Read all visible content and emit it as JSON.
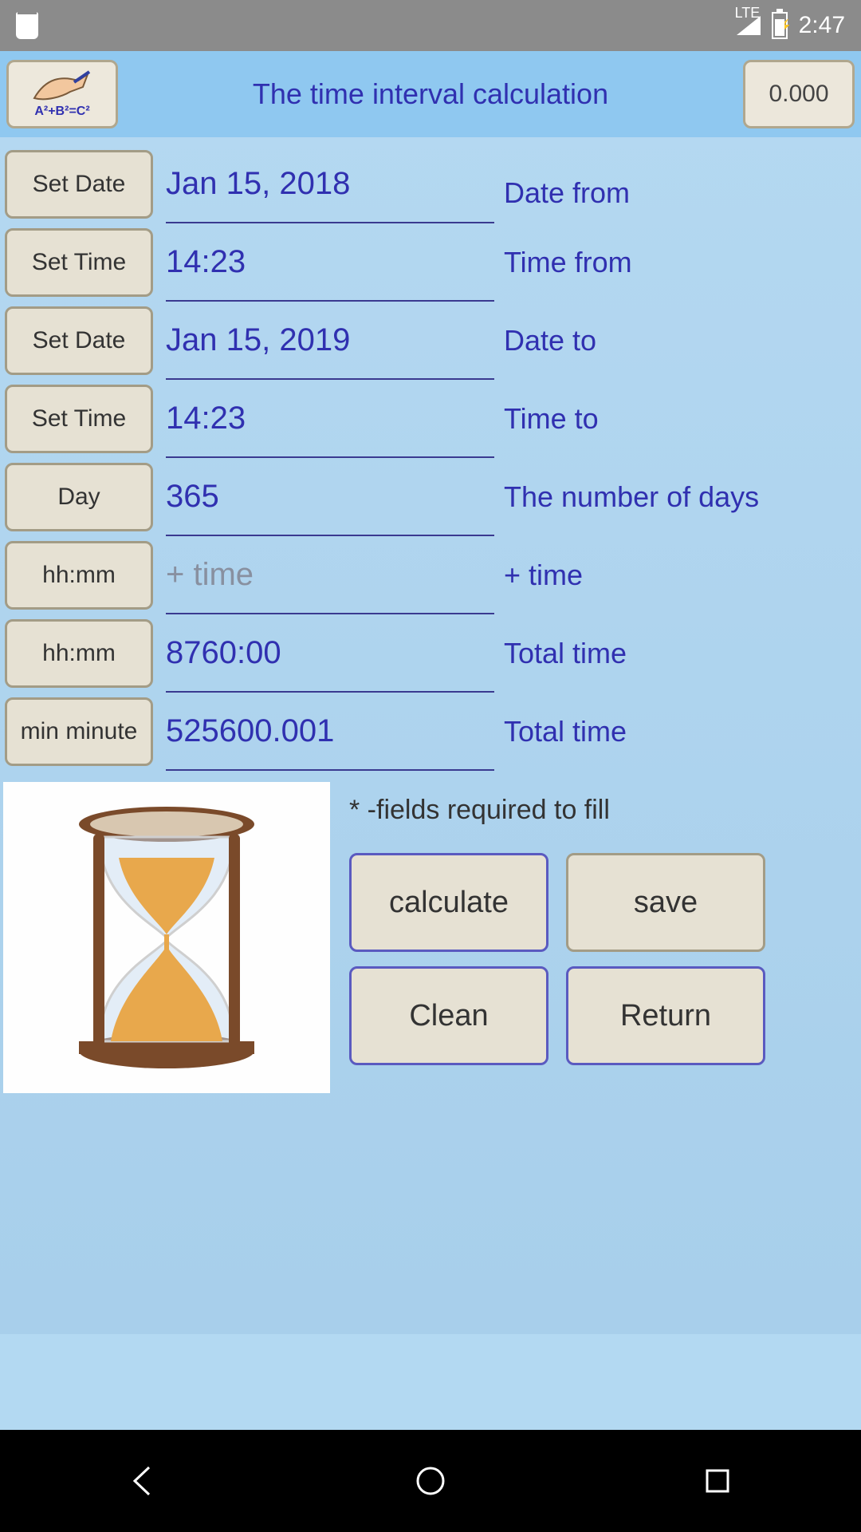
{
  "statusbar": {
    "lte": "LTE",
    "time": "2:47"
  },
  "header": {
    "title": "The time interval calculation",
    "value": "0.000",
    "formula": "A²+B²=C²"
  },
  "rows": {
    "buttons": {
      "set_date_from": "Set Date",
      "set_time_from": "Set Time",
      "set_date_to": "Set Date",
      "set_time_to": "Set Time",
      "day": "Day",
      "hhmm_plus": "hh:mm",
      "hhmm_total": "hh:mm",
      "min_minute": "min minute"
    },
    "values": {
      "date_from": "Jan 15, 2018",
      "time_from": "14:23",
      "date_to": "Jan 15, 2019",
      "time_to": "14:23",
      "days": "365",
      "plus_time_placeholder": "+ time",
      "total_hhmm": "8760:00",
      "total_min": "525600.001"
    },
    "labels": {
      "date_from": "Date from",
      "time_from": "Time from",
      "date_to": "Date to",
      "time_to": "Time to",
      "num_days": "The number of days",
      "plus_time": "+ time",
      "total_time_1": "Total time",
      "total_time_2": "Total time"
    }
  },
  "footer": {
    "note": "* -fields required to fill",
    "calculate": "calculate",
    "save": "save",
    "clean": "Clean",
    "return": "Return"
  }
}
